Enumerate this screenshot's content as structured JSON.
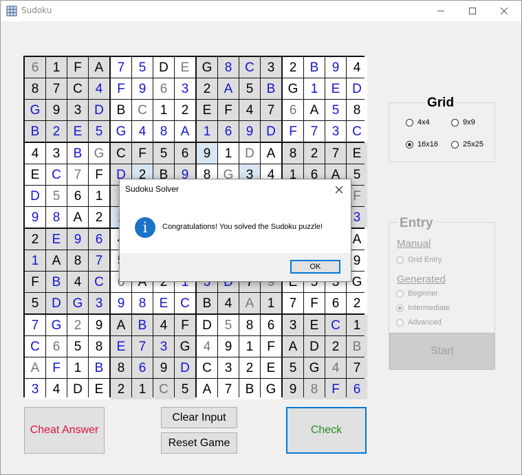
{
  "window": {
    "title": "Sudoku",
    "icon": "sudoku-grid-icon"
  },
  "board": {
    "size": 16,
    "rows": [
      [
        "6",
        "1",
        "F",
        "A",
        "7",
        "5",
        "D",
        "E",
        "G",
        "8",
        "C",
        "3",
        "2",
        "B",
        "9",
        "4"
      ],
      [
        "8",
        "7",
        "C",
        "4",
        "F",
        "9",
        "6",
        "3",
        "2",
        "A",
        "5",
        "B",
        "G",
        "1",
        "E",
        "D"
      ],
      [
        "G",
        "9",
        "3",
        "D",
        "B",
        "C",
        "1",
        "2",
        "E",
        "F",
        "4",
        "7",
        "6",
        "A",
        "5",
        "8"
      ],
      [
        "B",
        "2",
        "E",
        "5",
        "G",
        "4",
        "8",
        "A",
        "1",
        "6",
        "9",
        "D",
        "F",
        "7",
        "3",
        "C"
      ],
      [
        "4",
        "3",
        "B",
        "G",
        "C",
        "F",
        "5",
        "6",
        "9",
        "1",
        "D",
        "A",
        "8",
        "2",
        "7",
        "E"
      ],
      [
        "E",
        "C",
        "7",
        "F",
        "D",
        "2",
        "B",
        "9",
        "8",
        "G",
        "3",
        "4",
        "1",
        "6",
        "A",
        "5"
      ],
      [
        "D",
        "5",
        "6",
        "1",
        "",
        "",
        "",
        "",
        "",
        "",
        "",
        "",
        "",
        "",
        "",
        "F"
      ],
      [
        "9",
        "8",
        "A",
        "2",
        "1",
        "",
        "",
        "",
        "",
        "",
        "",
        "",
        "",
        "",
        "",
        "3"
      ],
      [
        "2",
        "E",
        "9",
        "6",
        "4",
        "",
        "",
        "",
        "",
        "",
        "",
        "",
        "",
        "",
        "",
        "A"
      ],
      [
        "1",
        "A",
        "8",
        "7",
        "5",
        "",
        "",
        "",
        "",
        "",
        "",
        "",
        "",
        "",
        "",
        "9"
      ],
      [
        "F",
        "B",
        "4",
        "C",
        "6",
        "A",
        "2",
        "1",
        "3",
        "D",
        "7",
        "9",
        "E",
        "5",
        "3",
        "G"
      ],
      [
        "5",
        "D",
        "G",
        "3",
        "9",
        "8",
        "E",
        "C",
        "B",
        "4",
        "A",
        "1",
        "7",
        "F",
        "6",
        "2"
      ],
      [
        "7",
        "G",
        "2",
        "9",
        "A",
        "B",
        "4",
        "F",
        "D",
        "5",
        "8",
        "6",
        "3",
        "E",
        "C",
        "1"
      ],
      [
        "C",
        "6",
        "5",
        "8",
        "E",
        "7",
        "3",
        "G",
        "4",
        "9",
        "1",
        "F",
        "A",
        "D",
        "2",
        "B"
      ],
      [
        "A",
        "F",
        "1",
        "B",
        "8",
        "6",
        "9",
        "D",
        "C",
        "3",
        "2",
        "E",
        "5",
        "G",
        "4",
        "7"
      ],
      [
        "3",
        "4",
        "D",
        "E",
        "2",
        "1",
        "C",
        "5",
        "A",
        "7",
        "B",
        "G",
        "9",
        "8",
        "F",
        "6"
      ]
    ],
    "kinds": [
      "giggbbgggbbggbbg",
      "gggbbbgbgbgbgbbb",
      "bggbggggggggggbg",
      "bbbbbbbbbbbbbbbb",
      "ggbggggggggggggg",
      "gbggbggbgggggggg",
      "bggggggggggggggg",
      "bbgggggggggggggb",
      "gbbbgggggggggggg",
      "bggbgggggggggggg",
      "gbgbgggbbbgggggg",
      "gbbbbbbbgggggggg",
      "bbgggbggggggggbg",
      "bgggbbbggggggggg",
      "gbgbgbgbggggggggg",
      "bgggggggggggggbb"
    ],
    "colors": {
      "given": "#000000",
      "entered": "#1414d2",
      "faded": "#777777"
    }
  },
  "buttons": {
    "cheat": "Cheat Answer",
    "clear": "Clear Input",
    "reset": "Reset Game",
    "check": "Check"
  },
  "grid_panel": {
    "title": "Grid",
    "options": [
      "4x4",
      "9x9",
      "16x16",
      "25x25"
    ],
    "selected": "16x16"
  },
  "entry_panel": {
    "title": "Entry",
    "manual_label": "Manual",
    "manual_options": [
      "Grid Entry"
    ],
    "generated_label": "Generated",
    "generated_options": [
      "Beginner",
      "Intermediate",
      "Advanced"
    ],
    "selected": "Intermediate",
    "start_label": "Start"
  },
  "dialog": {
    "title": "Sudoku Solver",
    "message": "Congratulations! You solved the Sudoku puzzle!",
    "ok_label": "OK",
    "icon": "info-icon"
  },
  "accent_colors": {
    "cheat": "#dc143c",
    "check": "#228b22",
    "focus": "#0078d7"
  }
}
